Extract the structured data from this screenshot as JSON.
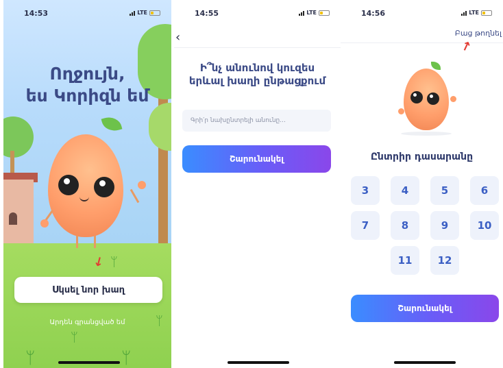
{
  "colors": {
    "accent_gradient_start": "#3a8dff",
    "accent_gradient_end": "#8a47ea",
    "title": "#3b4a86",
    "arrow": "#e23c33"
  },
  "screen1": {
    "status": {
      "time": "14:53",
      "network": "LTE"
    },
    "title_line1": "Ողջույն,",
    "title_line2": "ես Կորիզն եմ",
    "start_button": "Սկսել նոր խաղ",
    "registered_link": "Արդեն գրանցված եմ",
    "character": "mango-mascot"
  },
  "screen2": {
    "status": {
      "time": "14:55",
      "network": "LTE"
    },
    "back_icon": "chevron-left-icon",
    "question_line1": "Ի՞նչ անունով կուզես",
    "question_line2": "երևալ խաղի ընթացքում",
    "name_placeholder": "Գրի՛ր նախընտրելի անունը...",
    "continue_button": "Շարունակել"
  },
  "screen3": {
    "status": {
      "time": "14:56",
      "network": "LTE"
    },
    "skip_link": "Բաց թողնել",
    "choose_title": "Ընտրիր դասարանը",
    "grades": [
      "3",
      "4",
      "5",
      "6",
      "7",
      "8",
      "9",
      "10",
      "11",
      "12"
    ],
    "continue_button": "Շարունակել"
  }
}
